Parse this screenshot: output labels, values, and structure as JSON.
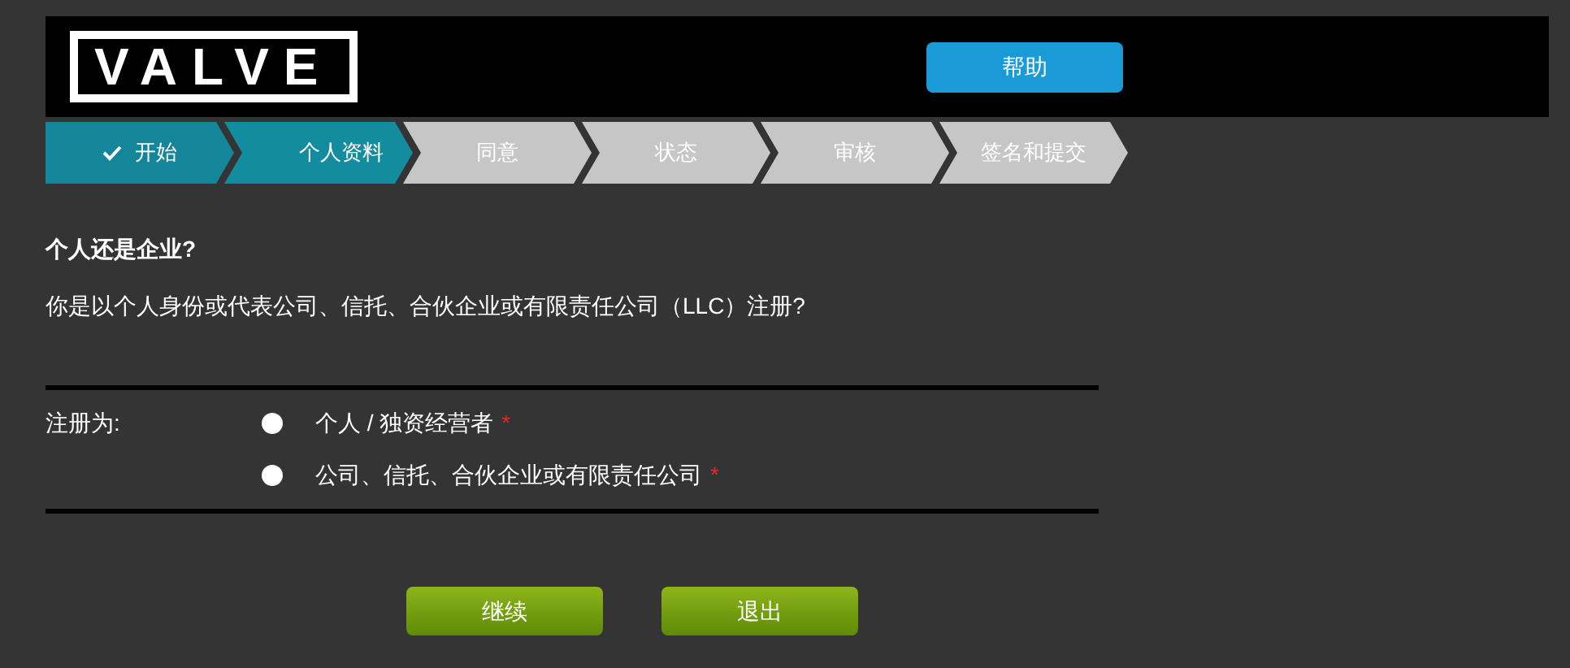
{
  "header": {
    "logo": "VALVE",
    "help_button": "帮助"
  },
  "steps": [
    {
      "label": "开始",
      "completed": true,
      "selected": false
    },
    {
      "label": "个人资料",
      "completed": false,
      "selected": true
    },
    {
      "label": "同意",
      "completed": false,
      "selected": false
    },
    {
      "label": "状态",
      "completed": false,
      "selected": false
    },
    {
      "label": "审核",
      "completed": false,
      "selected": false
    },
    {
      "label": "签名和提交",
      "completed": false,
      "selected": false
    }
  ],
  "heading": "个人还是企业?",
  "question": "你是以个人身份或代表公司、信托、合伙企业或有限责任公司（LLC）注册?",
  "register_as": {
    "label": "注册为:",
    "options": [
      {
        "label": "个人 / 独资经营者",
        "selected": false,
        "required": true,
        "required_mark": "*"
      },
      {
        "label": "公司、信托、合伙企业或有限责任公司",
        "selected": false,
        "required": true,
        "required_mark": "*"
      }
    ]
  },
  "buttons": [
    "继续",
    "退出"
  ]
}
